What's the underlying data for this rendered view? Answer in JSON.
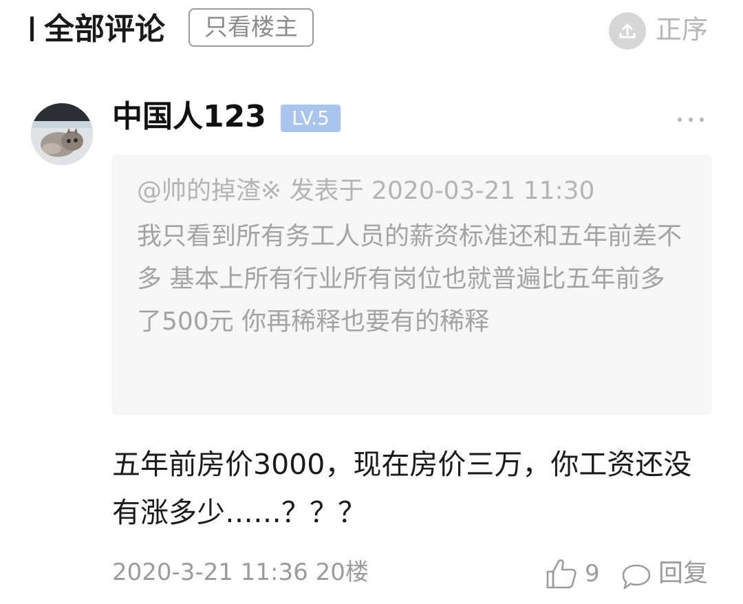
{
  "header": {
    "title": "全部评论",
    "op_only_label": "只看楼主",
    "sort_label": "正序"
  },
  "comment": {
    "username": "中国人123",
    "level": "LV.5",
    "quote": {
      "meta": "@帅的掉渣※ 发表于 2020-03-21 11:30",
      "text": "我只看到所有务工人员的薪资标准还和五年前差不多 基本上所有行业所有岗位也就普遍比五年前多了500元  你再稀释也要有的稀释"
    },
    "body": "五年前房价3000，现在房价三万，你工资还没有涨多少……？？？",
    "timestamp": "2020-3-21 11:36",
    "floor": "20楼",
    "like_count": "9",
    "reply_label": "回复"
  },
  "colors": {
    "level_badge": "#a9c5ee",
    "quote_bg": "#f6f6f6",
    "muted_text": "#9b9b9b"
  },
  "icons": {
    "sort": "sort-upload-icon",
    "more": "more-dots-icon",
    "like": "thumbs-up-icon",
    "reply": "speech-bubble-icon"
  }
}
